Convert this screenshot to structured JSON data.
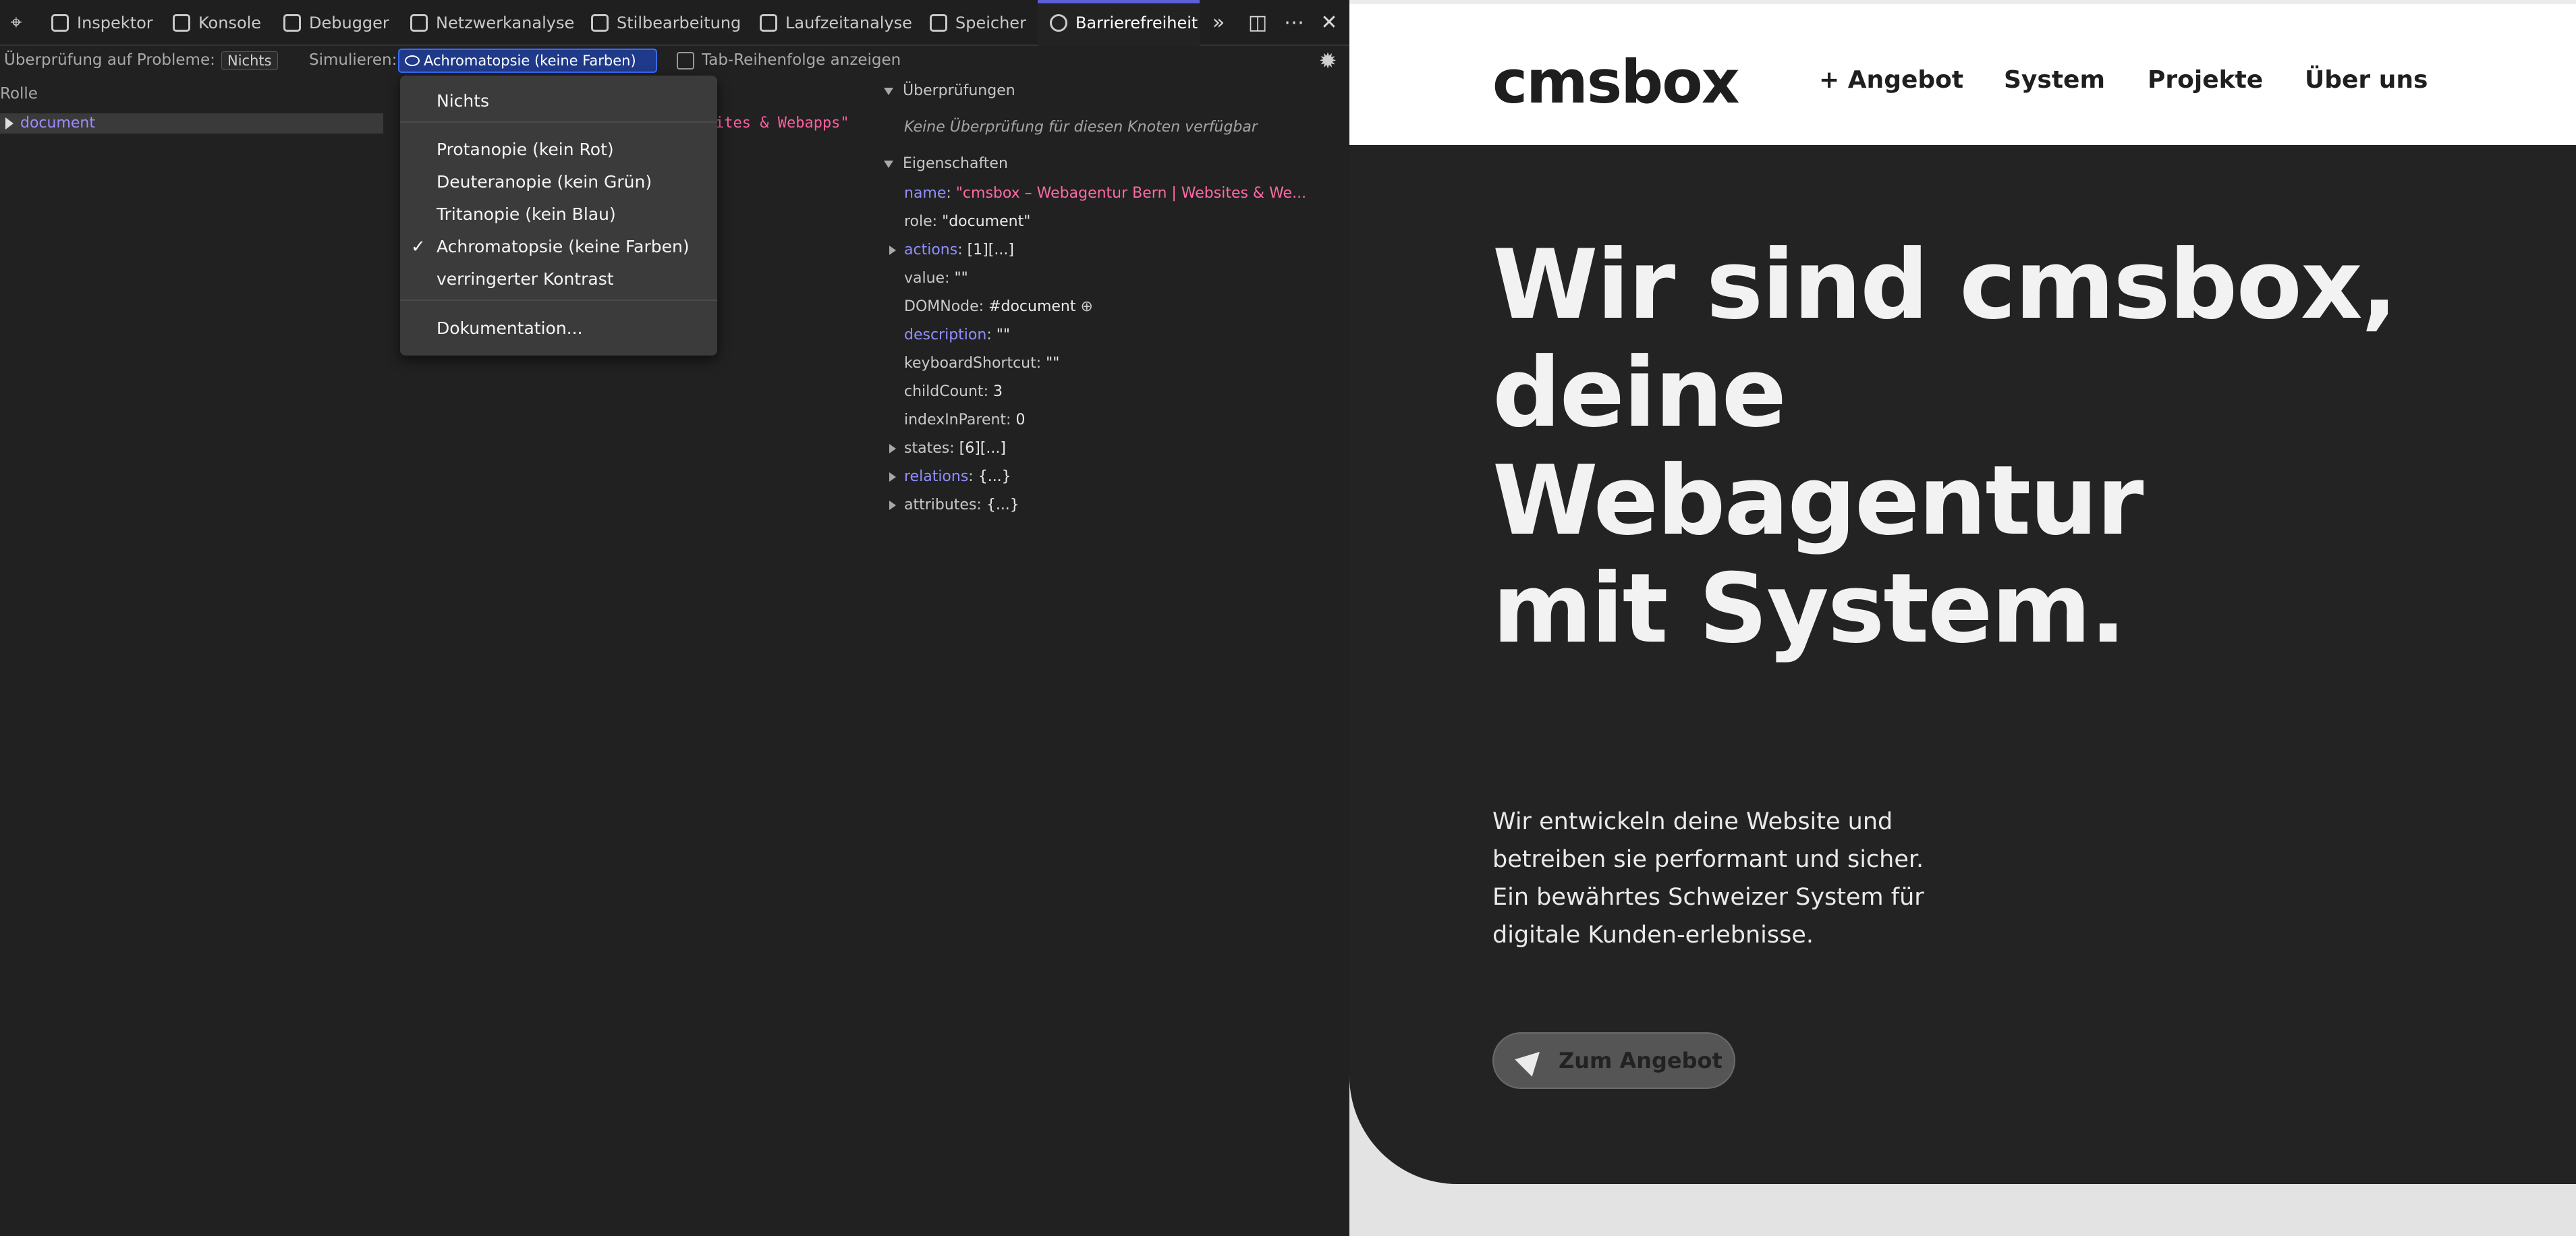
{
  "devtools": {
    "tabs": [
      "Inspektor",
      "Konsole",
      "Debugger",
      "Netzwerkanalyse",
      "Stilbearbeitung",
      "Laufzeitanalyse",
      "Speicher",
      "Barrierefreiheit"
    ],
    "check_label": "Überprüfung auf Probleme:",
    "check_value": "Nichts",
    "simulate_label": "Simulieren:",
    "simulate_value": "Achromatopsie (keine Farben)",
    "tab_order_label": "Tab-Reihenfolge anzeigen",
    "tree_header": "Rolle",
    "tree_node": "document",
    "tree_name": "ites & Webapps\"",
    "dropdown": {
      "items": [
        "Nichts",
        "Protanopie (kein Rot)",
        "Deuteranopie (kein Grün)",
        "Tritanopie (kein Blau)",
        "Achromatopsie (keine Farben)",
        "verringerter Kontrast",
        "Dokumentation..."
      ],
      "checked": "Achromatopsie (keine Farben)"
    },
    "checks_title": "Überprüfungen",
    "checks_note": "Keine Überprüfung für diesen Knoten verfügbar",
    "props_title": "Eigenschaften",
    "props": [
      {
        "key": "name",
        "value": "\"cmsbox – Webagentur Bern | Websites & We..."
      },
      {
        "key": "role",
        "value": "\"document\""
      },
      {
        "key": "actions",
        "value": "[1][...]"
      },
      {
        "key": "value",
        "value": "\"\""
      },
      {
        "key": "DOMNode",
        "value": "#document"
      },
      {
        "key": "description",
        "value": "\"\""
      },
      {
        "key": "keyboardShortcut",
        "value": "\"\""
      },
      {
        "key": "childCount",
        "value": "3"
      },
      {
        "key": "indexInParent",
        "value": "0"
      },
      {
        "key": "states",
        "value": "[6][...]"
      },
      {
        "key": "relations",
        "value": "{...}"
      },
      {
        "key": "attributes",
        "value": "{...}"
      }
    ]
  },
  "site": {
    "logo": "cmsbox",
    "nav": [
      "+ Angebot",
      "System",
      "Projekte",
      "Über uns"
    ],
    "hero_title": "Wir sind cmsbox,\ndeine Webagentur\nmit System.",
    "hero_text": "Wir entwickeln deine Website und betreiben sie performant und sicher. Ein bewährtes Schweizer System für digitale Kunden-erlebnisse.",
    "cta": "Zum Angebot"
  },
  "colors": {
    "devtools_bg": "#212121",
    "accent": "#5b5fd8",
    "select_bg": "#1f3a8a",
    "string_value": "#ff6aa5",
    "hero_bg": "#232323",
    "header_bg": "#ffffff"
  }
}
